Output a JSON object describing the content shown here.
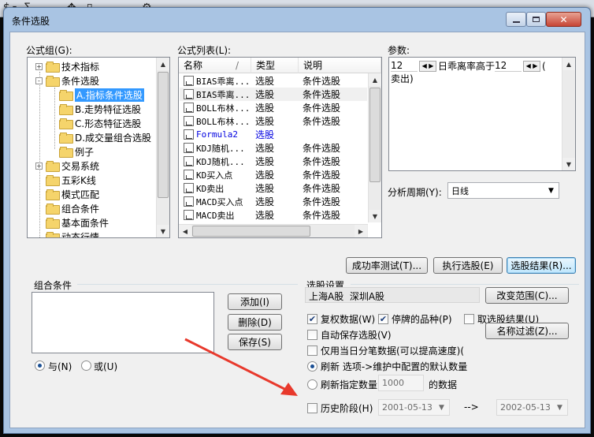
{
  "window": {
    "title": "条件选股"
  },
  "groups": {
    "label": "公式组(G):",
    "items": [
      {
        "label": "技术指标",
        "expander": "+",
        "level": 0
      },
      {
        "label": "条件选股",
        "expander": "-",
        "level": 0
      },
      {
        "label": "A.指标条件选股",
        "level": 1,
        "selected": true
      },
      {
        "label": "B.走势特征选股",
        "level": 1
      },
      {
        "label": "C.形态特征选股",
        "level": 1
      },
      {
        "label": "D.成交量组合选股",
        "level": 1
      },
      {
        "label": "例子",
        "level": 1
      },
      {
        "label": "交易系统",
        "expander": "+",
        "level": 0
      },
      {
        "label": "五彩K线",
        "level": 0
      },
      {
        "label": "模式匹配",
        "level": 0
      },
      {
        "label": "组合条件",
        "level": 0
      },
      {
        "label": "基本面条件",
        "level": 0
      },
      {
        "label": "动态行情",
        "level": 0
      }
    ]
  },
  "formula_list": {
    "label": "公式列表(L):",
    "columns": [
      "名称",
      "/",
      "类型",
      "说明"
    ],
    "rows": [
      {
        "name": "BIAS乖离...",
        "type": "选股",
        "desc": "条件选股"
      },
      {
        "name": "BIAS乖离...",
        "type": "选股",
        "desc": "条件选股"
      },
      {
        "name": "BOLL布林...",
        "type": "选股",
        "desc": "条件选股"
      },
      {
        "name": "BOLL布林...",
        "type": "选股",
        "desc": "条件选股"
      },
      {
        "name": "Formula2",
        "type": "选股",
        "desc": "",
        "highlight": true
      },
      {
        "name": "KDJ随机...",
        "type": "选股",
        "desc": "条件选股"
      },
      {
        "name": "KDJ随机...",
        "type": "选股",
        "desc": "条件选股"
      },
      {
        "name": "KD买入点",
        "type": "选股",
        "desc": "条件选股"
      },
      {
        "name": "KD卖出",
        "type": "选股",
        "desc": "条件选股"
      },
      {
        "name": "MACD买入点",
        "type": "选股",
        "desc": "条件选股"
      },
      {
        "name": "MACD卖出",
        "type": "选股",
        "desc": "条件选股"
      }
    ]
  },
  "params": {
    "label": "参数:",
    "value1": "12",
    "text1": "日乖离率高于",
    "value2": "12",
    "text2": "(",
    "text3": "卖出)",
    "period_label": "分析周期(Y):",
    "period_value": "日线"
  },
  "buttons": {
    "success_test": "成功率测试(T)...",
    "execute": "执行选股(E)",
    "result": "选股结果(R)...",
    "add": "添加(I)",
    "delete": "删除(D)",
    "save": "保存(S)",
    "change_range": "改变范围(C)...",
    "name_filter": "名称过滤(Z)..."
  },
  "combo": {
    "label": "组合条件",
    "and_label": "与(N)",
    "or_label": "或(U)"
  },
  "settings": {
    "label": "选股设置",
    "range_text": "上海A股  深圳A股",
    "options": [
      {
        "label": "复权数据(W)",
        "checked": true
      },
      {
        "label": "停牌的品种(P)",
        "checked": true
      },
      {
        "label": "取选股结果(U)",
        "checked": false
      },
      {
        "label": "自动保存选股(V)",
        "checked": false
      },
      {
        "label": "仅用当日分笔数据(可以提高速度)(",
        "checked": false
      }
    ],
    "refresh_label": "刷新 选项->维护中配置的默认数量",
    "refresh_count_label": "刷新指定数量",
    "refresh_count_value": "1000",
    "refresh_count_suffix": "的数据",
    "history_label": "历史阶段(H)",
    "date_from": "2001-05-13",
    "date_sep": "-->",
    "date_to": "2002-05-13"
  },
  "colors": {
    "selection": "#3399ff",
    "annotation_arrow": "#e8392c",
    "title_bar": "#a9c4e3"
  },
  "icons": {
    "folder": "folder-icon",
    "formula": "formula-icon",
    "arrow": "annotation-arrow"
  }
}
